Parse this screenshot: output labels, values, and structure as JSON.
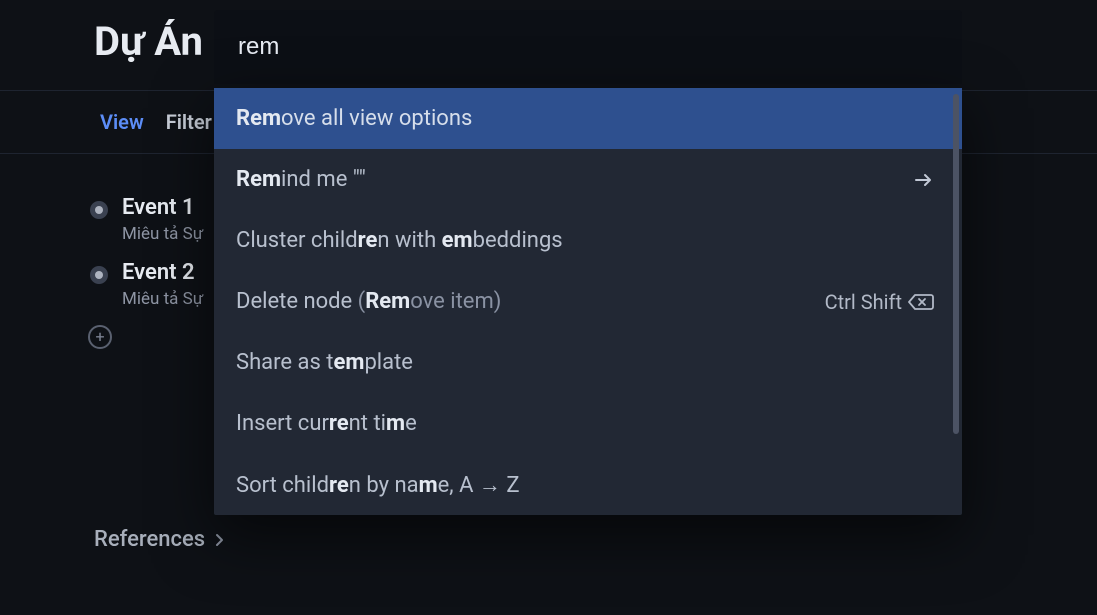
{
  "header": {
    "title": "Dự Án"
  },
  "toolbar": {
    "view_label": "View",
    "filter_label": "Filter"
  },
  "events": [
    {
      "title": "Event 1",
      "desc": "Miêu tả Sự"
    },
    {
      "title": "Event 2",
      "desc": "Miêu tả Sự"
    }
  ],
  "references_label": "References",
  "palette": {
    "query": "rem",
    "items": [
      {
        "html": "<span class='hl'>Rem</span>ove all view options",
        "selected": true
      },
      {
        "html": "<span class='hl'>Rem</span>ind me \"\"",
        "trailing": "arrow"
      },
      {
        "html": "Cluster child<span class='hl'>re</span>n with <span class='hl'>em</span>beddings"
      },
      {
        "html": "Delete node <span class='dim'>(<span class='hl'>Rem</span>ove item)</span>",
        "shortcut": "Ctrl Shift",
        "shortcut_icon": "backspace"
      },
      {
        "html": "Share as t<span class='hl'>em</span>plate"
      },
      {
        "html": "Insert cur<span class='hl'>re</span>nt ti<span class='hl'>m</span>e"
      },
      {
        "html": "Sort child<span class='hl'>re</span>n by na<span class='hl'>m</span>e, A → Z"
      }
    ]
  }
}
